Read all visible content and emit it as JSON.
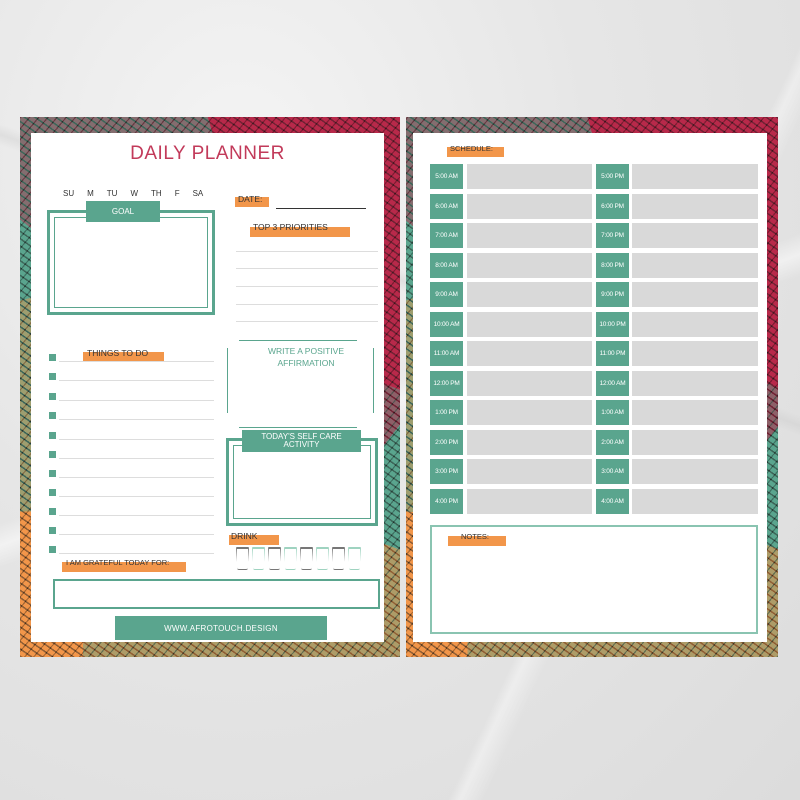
{
  "left_page": {
    "title": "DAILY PLANNER",
    "days": [
      "SU",
      "M",
      "TU",
      "W",
      "TH",
      "F",
      "SA"
    ],
    "date_label": "DATE:",
    "goal_label": "GOAL",
    "priorities_label": "TOP 3 PRIORITIES",
    "things_to_do_label": "THINGS TO DO",
    "todo_count": 11,
    "affirmation_label": [
      "WRITE A POSITIVE",
      "AFFIRMATION"
    ],
    "self_care_label": [
      "TODAY'S SELF CARE",
      "ACTIVITY"
    ],
    "drink_label": "DRINK",
    "cups": [
      "gray",
      "mint",
      "gray",
      "mint",
      "gray",
      "mint",
      "gray",
      "mint"
    ],
    "grateful_label": "I AM GRATEFUL TODAY FOR:",
    "website": "WWW.AFROTOUCH.DESIGN"
  },
  "right_page": {
    "schedule_label": "SCHEDULE:",
    "left_times": [
      "5:00 AM",
      "6:00 AM",
      "7:00 AM",
      "8:00 AM",
      "9:00 AM",
      "10:00 AM",
      "11:00 AM",
      "12:00 PM",
      "1:00 PM",
      "2:00 PM",
      "3:00 PM",
      "4:00 PM"
    ],
    "right_times": [
      "5:00 PM",
      "6:00 PM",
      "7:00 PM",
      "8:00 PM",
      "9:00 PM",
      "10:00 PM",
      "11:00 PM",
      "12:00 AM",
      "1:00 AM",
      "2:00 AM",
      "3:00 AM",
      "4:00 AM"
    ],
    "notes_label": "NOTES:"
  },
  "colors": {
    "teal": "#5aa58e",
    "orange": "#f2964a",
    "crimson": "#c23a5a",
    "slot_gray": "#d9d9d9"
  }
}
